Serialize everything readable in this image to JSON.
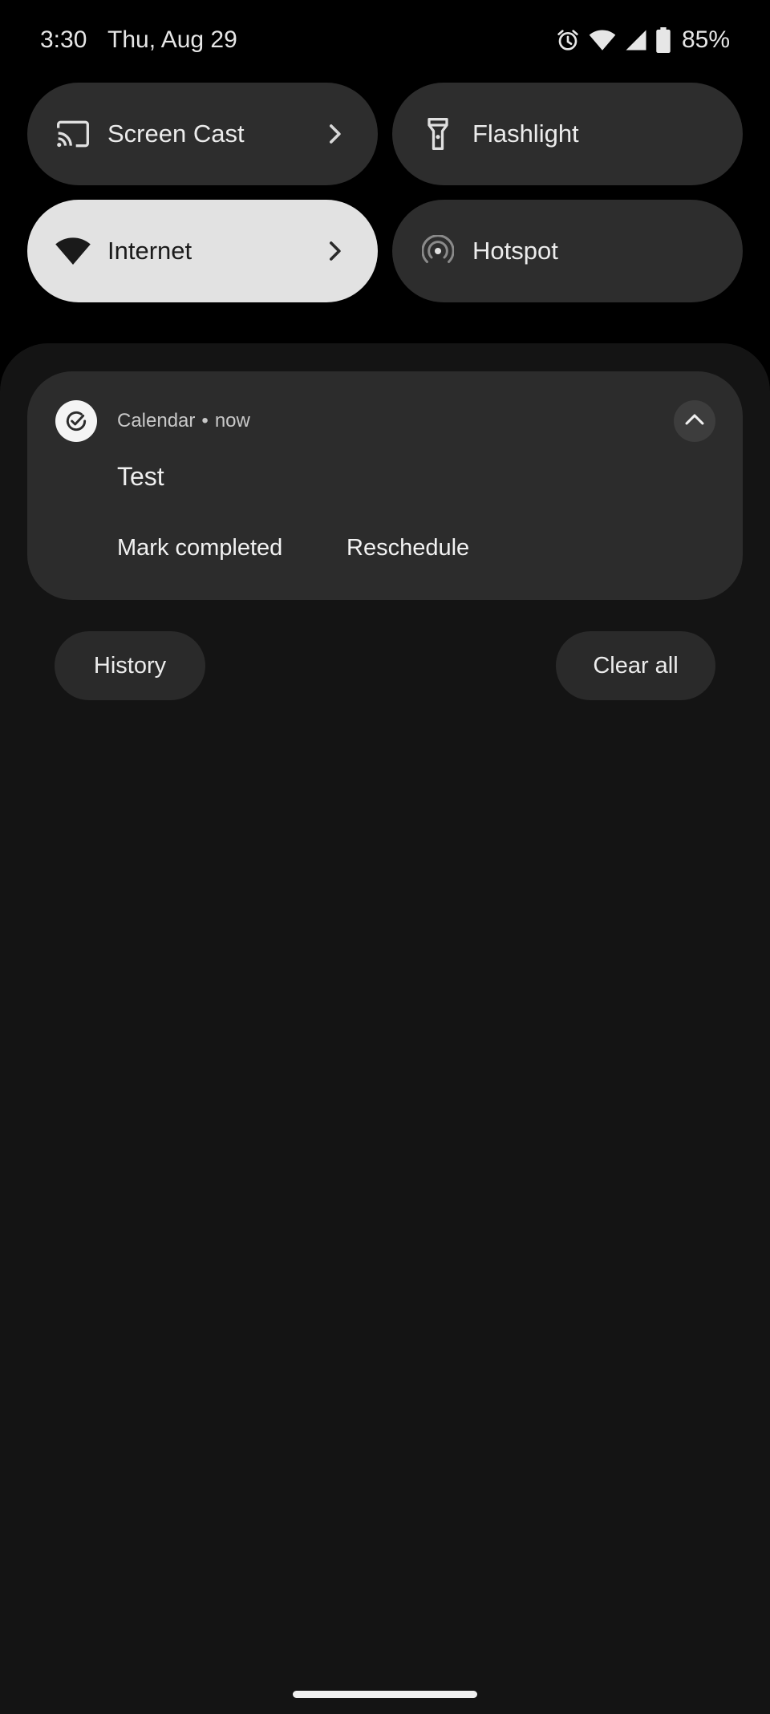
{
  "status_bar": {
    "time": "3:30",
    "date": "Thu, Aug 29",
    "battery_percent": "85%",
    "icons": [
      "alarm-icon",
      "wifi-icon",
      "cell-signal-icon",
      "battery-icon"
    ]
  },
  "quick_settings": {
    "tiles": [
      {
        "label": "Screen Cast",
        "icon": "cast-icon",
        "active": false,
        "has_chevron": true
      },
      {
        "label": "Flashlight",
        "icon": "flashlight-icon",
        "active": false,
        "has_chevron": false
      },
      {
        "label": "Internet",
        "icon": "wifi-icon",
        "active": true,
        "has_chevron": true
      },
      {
        "label": "Hotspot",
        "icon": "hotspot-icon",
        "active": false,
        "has_chevron": false
      }
    ]
  },
  "notification": {
    "app_name": "Calendar",
    "separator": "•",
    "time": "now",
    "title": "Test",
    "actions": [
      "Mark completed",
      "Reschedule"
    ],
    "app_icon": "calendar-check-icon",
    "expand_icon": "chevron-up-icon"
  },
  "footer_buttons": {
    "history": "History",
    "clear_all": "Clear all"
  },
  "colors": {
    "background": "#000000",
    "shade": "#141414",
    "tile": "#2d2d2d",
    "tile_active": "#e2e2e2",
    "card": "#2c2c2c"
  }
}
